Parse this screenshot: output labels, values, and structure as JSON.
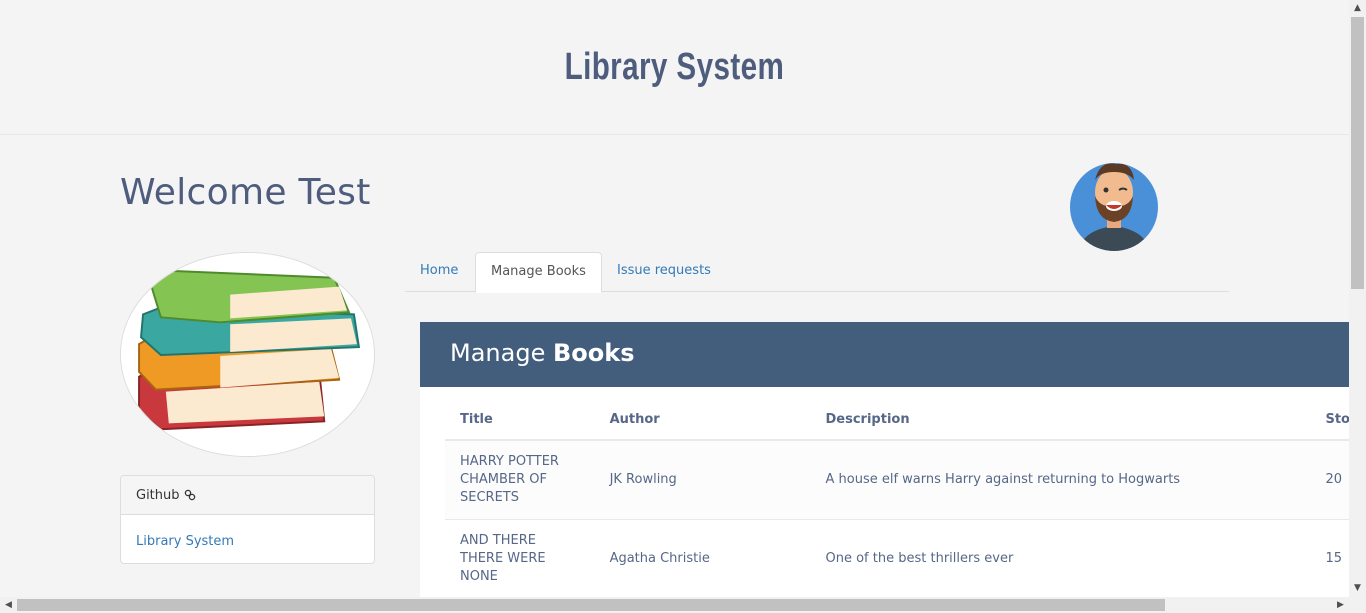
{
  "site": {
    "title": "Library System"
  },
  "user": {
    "welcome": "Welcome Test"
  },
  "sidebar": {
    "panel_title": "Github",
    "panel_link": "Library System"
  },
  "tabs": [
    {
      "label": "Home"
    },
    {
      "label": "Manage Books"
    },
    {
      "label": "Issue requests"
    }
  ],
  "manage": {
    "heading_normal": "Manage",
    "heading_bold": "Books",
    "columns": [
      "Title",
      "Author",
      "Description",
      "Sto"
    ],
    "rows": [
      {
        "title": "HARRY POTTER CHAMBER OF SECRETS",
        "author": "JK Rowling",
        "description": "A house elf warns Harry against returning to Hogwarts",
        "stock": "20"
      },
      {
        "title": "AND THERE THERE WERE NONE",
        "author": "Agatha Christie",
        "description": "One of the best thrillers ever",
        "stock": "15"
      }
    ]
  },
  "colors": {
    "header_bar": "#435d7d",
    "title": "#4e5d7d",
    "link": "#337ab7"
  }
}
